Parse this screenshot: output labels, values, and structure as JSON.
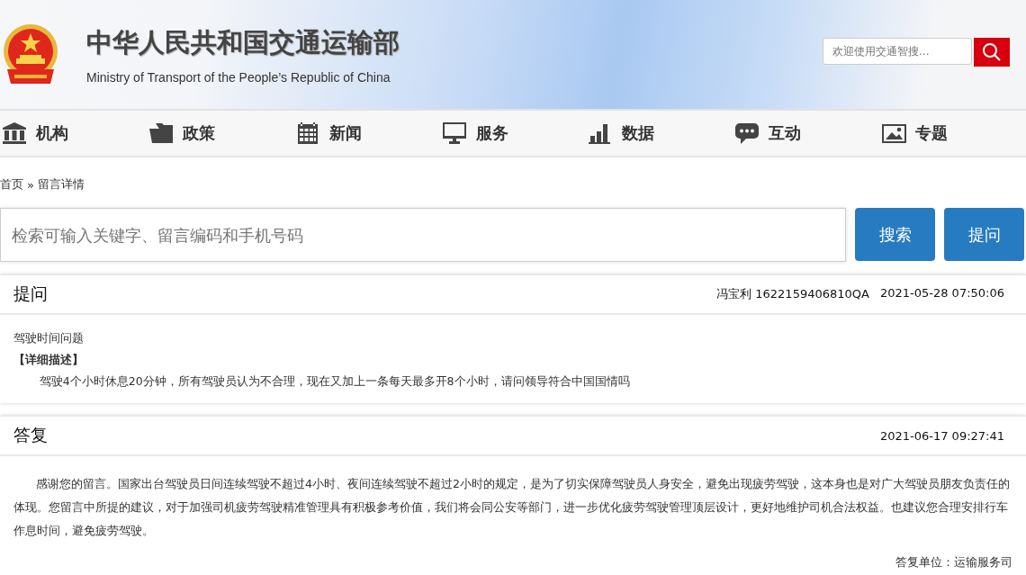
{
  "header": {
    "title": "中华人民共和国交通运输部",
    "subtitle": "Ministry of Transport of the People’s Republic of China",
    "search": {
      "placeholder": "欢迎使用交通智搜..."
    }
  },
  "nav": [
    {
      "label": "机构"
    },
    {
      "label": "政策"
    },
    {
      "label": "新闻"
    },
    {
      "label": "服务"
    },
    {
      "label": "数据"
    },
    {
      "label": "互动"
    },
    {
      "label": "专题"
    }
  ],
  "breadcrumb": {
    "home": "首页",
    "separator": "»",
    "current": "留言详情"
  },
  "search_bar": {
    "placeholder": "检索可输入关键字、留言编码和手机号码",
    "buttons": [
      "搜索",
      "提问"
    ]
  },
  "question": {
    "heading": "提问",
    "author": "冯宝利 1622159406810QA",
    "time": "2021-05-28 07:50:06",
    "subject": "驾驶时间问题",
    "label": "【详细描述】",
    "body": "驾驶4个小时休息20分钟，所有驾驶员认为不合理，现在又加上一条每天最多开8个小时，请问领导符合中国国情吗"
  },
  "answer": {
    "heading": "答复",
    "time": "2021-06-17 09:27:41",
    "body": "感谢您的留言。国家出台驾驶员日间连续驾驶不超过4小时、夜间连续驾驶不超过2小时的规定，是为了切实保障驾驶员人身安全，避免出现疲劳驾驶，这本身也是对广大驾驶员朋友负责任的体现。您留言中所提的建议，对于加强司机疲劳驾驶精准管理具有积极参考价值，我们将会同公安等部门，进一步优化疲劳驾驶管理顶层设计，更好地维护司机合法权益。也建议您合理安排行车作息时间，避免疲劳驾驶。",
    "unit": "答复单位：运输服务司"
  }
}
